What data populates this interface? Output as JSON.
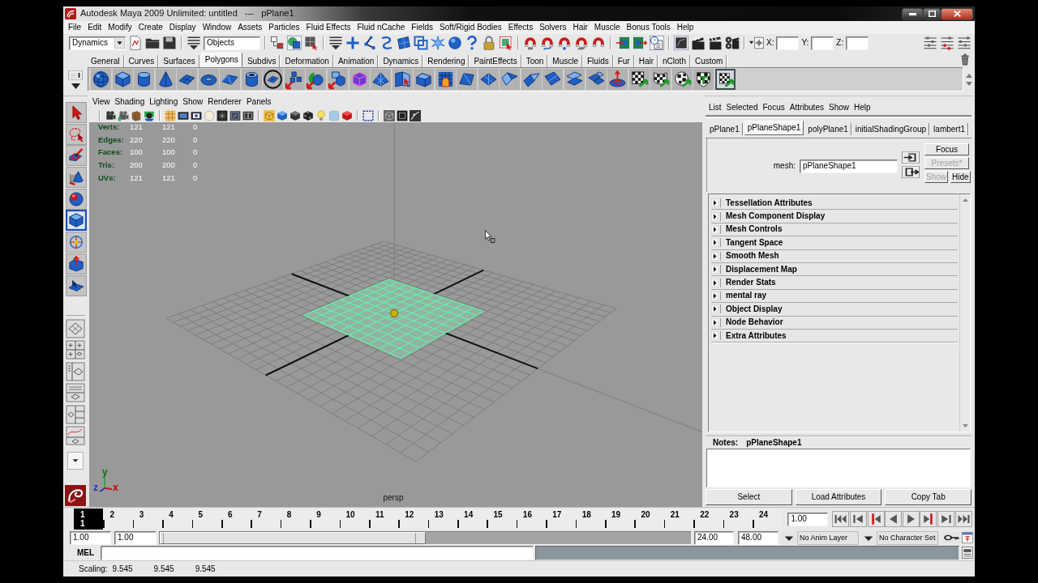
{
  "window": {
    "title": "Autodesk Maya 2009 Unlimited: untitled   ---   pPlane1"
  },
  "menu_bar": [
    "File",
    "Edit",
    "Modify",
    "Create",
    "Display",
    "Window",
    "Assets",
    "Particles",
    "Fluid Effects",
    "Fluid nCache",
    "Fields",
    "Soft/Rigid Bodies",
    "Effects",
    "Solvers",
    "Hair",
    "Muscle",
    "Bonus Tools",
    "Help"
  ],
  "status_line": {
    "menu_set": "Dynamics",
    "selection_mode": "Objects",
    "coordinates": [
      {
        "label": "X:"
      },
      {
        "label": "Y:"
      },
      {
        "label": "Z:"
      }
    ]
  },
  "shelf": {
    "tabs": [
      {
        "label": "General",
        "selected": false
      },
      {
        "label": "Curves",
        "selected": false
      },
      {
        "label": "Surfaces",
        "selected": false
      },
      {
        "label": "Polygons",
        "selected": true
      },
      {
        "label": "Subdivs",
        "selected": false
      },
      {
        "label": "Deformation",
        "selected": false
      },
      {
        "label": "Animation",
        "selected": false
      },
      {
        "label": "Dynamics",
        "selected": false
      },
      {
        "label": "Rendering",
        "selected": false
      },
      {
        "label": "PaintEffects",
        "selected": false
      },
      {
        "label": "Toon",
        "selected": false
      },
      {
        "label": "Muscle",
        "selected": false
      },
      {
        "label": "Fluids",
        "selected": false
      },
      {
        "label": "Fur",
        "selected": false
      },
      {
        "label": "Hair",
        "selected": false
      },
      {
        "label": "nCloth",
        "selected": false
      },
      {
        "label": "Custom",
        "selected": false
      }
    ]
  },
  "toolbox": {
    "tools": [
      {
        "kind": "select",
        "selected": false
      },
      {
        "kind": "lasso",
        "selected": false
      },
      {
        "kind": "paint",
        "selected": false
      },
      {
        "kind": "move",
        "selected": false
      },
      {
        "kind": "rotate",
        "selected": false
      },
      {
        "kind": "scale",
        "selected": true
      },
      {
        "kind": "manipulator",
        "selected": false
      },
      {
        "kind": "soft_mod",
        "selected": false
      },
      {
        "kind": "last_tool",
        "selected": false
      }
    ]
  },
  "viewport": {
    "menu": [
      "View",
      "Shading",
      "Lighting",
      "Show",
      "Renderer",
      "Panels"
    ],
    "hud": [
      {
        "label": "Verts:",
        "values": [
          "121",
          "121",
          "0"
        ]
      },
      {
        "label": "Edges:",
        "values": [
          "220",
          "220",
          "0"
        ]
      },
      {
        "label": "Faces:",
        "values": [
          "100",
          "100",
          "0"
        ]
      },
      {
        "label": "Tris:",
        "values": [
          "200",
          "200",
          "0"
        ]
      },
      {
        "label": "UVs:",
        "values": [
          "121",
          "121",
          "0"
        ]
      }
    ],
    "axis_labels": [
      {
        "label": "y",
        "color": "#0f6e0f"
      },
      {
        "label": "z",
        "color": "#2030c0"
      },
      {
        "label": "x",
        "color": "#c80000"
      }
    ],
    "camera": "persp"
  },
  "attribute_editor": {
    "menu": [
      "List",
      "Selected",
      "Focus",
      "Attributes",
      "Show",
      "Help"
    ],
    "tabs": [
      {
        "label": "pPlane1",
        "selected": false
      },
      {
        "label": "pPlaneShape1",
        "selected": true
      },
      {
        "label": "polyPlane1",
        "selected": false
      },
      {
        "label": "initialShadingGroup",
        "selected": false
      },
      {
        "label": "lambert1",
        "selected": false
      }
    ],
    "node_type": "mesh:",
    "node_name": "pPlaneShape1",
    "buttons": [
      {
        "label": "Focus",
        "disabled": false
      },
      {
        "label": "Presets*",
        "disabled": true
      },
      {
        "label": "Show",
        "disabled": true
      },
      {
        "label": "Hide",
        "disabled": false
      }
    ],
    "sections": [
      {
        "title": "Tessellation Attributes",
        "expanded": false
      },
      {
        "title": "Mesh Component Display",
        "expanded": false
      },
      {
        "title": "Mesh Controls",
        "expanded": false
      },
      {
        "title": "Tangent Space",
        "expanded": false
      },
      {
        "title": "Smooth Mesh",
        "expanded": false
      },
      {
        "title": "Displacement Map",
        "expanded": false
      },
      {
        "title": "Render Stats",
        "expanded": false
      },
      {
        "title": "mental ray",
        "expanded": false
      },
      {
        "title": "Object Display",
        "expanded": false
      },
      {
        "title": "Node Behavior",
        "expanded": false
      },
      {
        "title": "Extra Attributes",
        "expanded": false
      }
    ],
    "notes_label": "Notes:",
    "notes_node": "pPlaneShape1",
    "actions": [
      "Select",
      "Load Attributes",
      "Copy Tab"
    ]
  },
  "time_slider": {
    "frames": [
      {
        "label": "1",
        "selected": true
      },
      {
        "label": "2",
        "selected": false
      },
      {
        "label": "3",
        "selected": false
      },
      {
        "label": "4",
        "selected": false
      },
      {
        "label": "5",
        "selected": false
      },
      {
        "label": "6",
        "selected": false
      },
      {
        "label": "7",
        "selected": false
      },
      {
        "label": "8",
        "selected": false
      },
      {
        "label": "9",
        "selected": false
      },
      {
        "label": "10",
        "selected": false
      },
      {
        "label": "11",
        "selected": false
      },
      {
        "label": "12",
        "selected": false
      },
      {
        "label": "13",
        "selected": false
      },
      {
        "label": "14",
        "selected": false
      },
      {
        "label": "15",
        "selected": false
      },
      {
        "label": "16",
        "selected": false
      },
      {
        "label": "17",
        "selected": false
      },
      {
        "label": "18",
        "selected": false
      },
      {
        "label": "19",
        "selected": false
      },
      {
        "label": "20",
        "selected": false
      },
      {
        "label": "21",
        "selected": false
      },
      {
        "label": "22",
        "selected": false
      },
      {
        "label": "23",
        "selected": false
      },
      {
        "label": "24",
        "selected": false
      }
    ],
    "current_frame": "1",
    "current_time": "1.00"
  },
  "range_slider": {
    "start_time": "1.00",
    "range_start": "1.00",
    "level": 0.5,
    "range_end": "24.00",
    "end_time": "48.00",
    "anim_layer": "No Anim Layer",
    "character_set": "No Character Set"
  },
  "command_line": {
    "language": "MEL"
  },
  "help_line": {
    "label": "Scaling:",
    "values": [
      "9.545",
      "9.545",
      "9.545"
    ]
  }
}
